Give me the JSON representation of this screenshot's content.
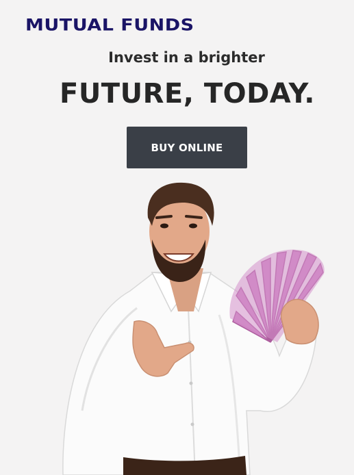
{
  "brand": {
    "logo_text": "MUTUAL FUNDS",
    "color": "#1a1466"
  },
  "hero": {
    "subtitle": "Invest in a brighter",
    "headline": "FUTURE, TODAY.",
    "cta_label": "BUY ONLINE",
    "cta_color": "#3a3f47"
  },
  "image": {
    "subject": "man-pointing-at-fan-of-rupee-notes"
  }
}
